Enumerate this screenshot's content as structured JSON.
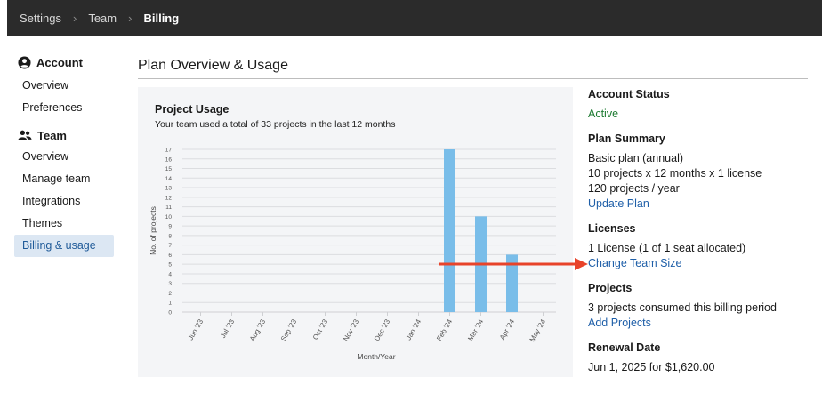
{
  "breadcrumb": [
    "Settings",
    "Team",
    "Billing"
  ],
  "sidebar": {
    "sections": [
      {
        "heading": "Account",
        "icon": "user-circle-icon",
        "items": [
          "Overview",
          "Preferences"
        ]
      },
      {
        "heading": "Team",
        "icon": "users-icon",
        "items": [
          "Overview",
          "Manage team",
          "Integrations",
          "Themes",
          "Billing & usage"
        ]
      }
    ],
    "active_item": "Billing & usage"
  },
  "page_title": "Plan Overview & Usage",
  "chart": {
    "title": "Project Usage",
    "subtitle": "Your team used a total of 33 projects in the last 12 months"
  },
  "chart_data": {
    "type": "bar",
    "categories": [
      "Jun '23",
      "Jul '23",
      "Aug '23",
      "Sep '23",
      "Oct '23",
      "Nov '23",
      "Dec '23",
      "Jan '24",
      "Feb '24",
      "Mar '24",
      "Apr '24",
      "May '24"
    ],
    "values": [
      0,
      0,
      0,
      0,
      0,
      0,
      0,
      0,
      17,
      10,
      6,
      0
    ],
    "xlabel": "Month/Year",
    "ylabel": "No. of projects",
    "ylim": [
      0,
      17
    ],
    "yticks": [
      0,
      1,
      2,
      3,
      4,
      5,
      6,
      7,
      8,
      9,
      10,
      11,
      12,
      13,
      14,
      15,
      16,
      17
    ],
    "bar_color": "#79bde9",
    "grid": true
  },
  "account_status": {
    "heading": "Account Status",
    "value": "Active",
    "color": "#1e7b32"
  },
  "plan_summary": {
    "heading": "Plan Summary",
    "lines": [
      "Basic plan (annual)",
      "10 projects x 12 months x 1 license",
      "120 projects / year"
    ],
    "link": "Update Plan"
  },
  "licenses": {
    "heading": "Licenses",
    "line": "1 License (1 of 1 seat allocated)",
    "link": "Change Team Size"
  },
  "projects": {
    "heading": "Projects",
    "line": "3 projects consumed this billing period",
    "link": "Add Projects"
  },
  "renewal": {
    "heading": "Renewal Date",
    "line": "Jun 1, 2025 for $1,620.00"
  },
  "annotation": {
    "arrow_color": "#e8432a"
  }
}
